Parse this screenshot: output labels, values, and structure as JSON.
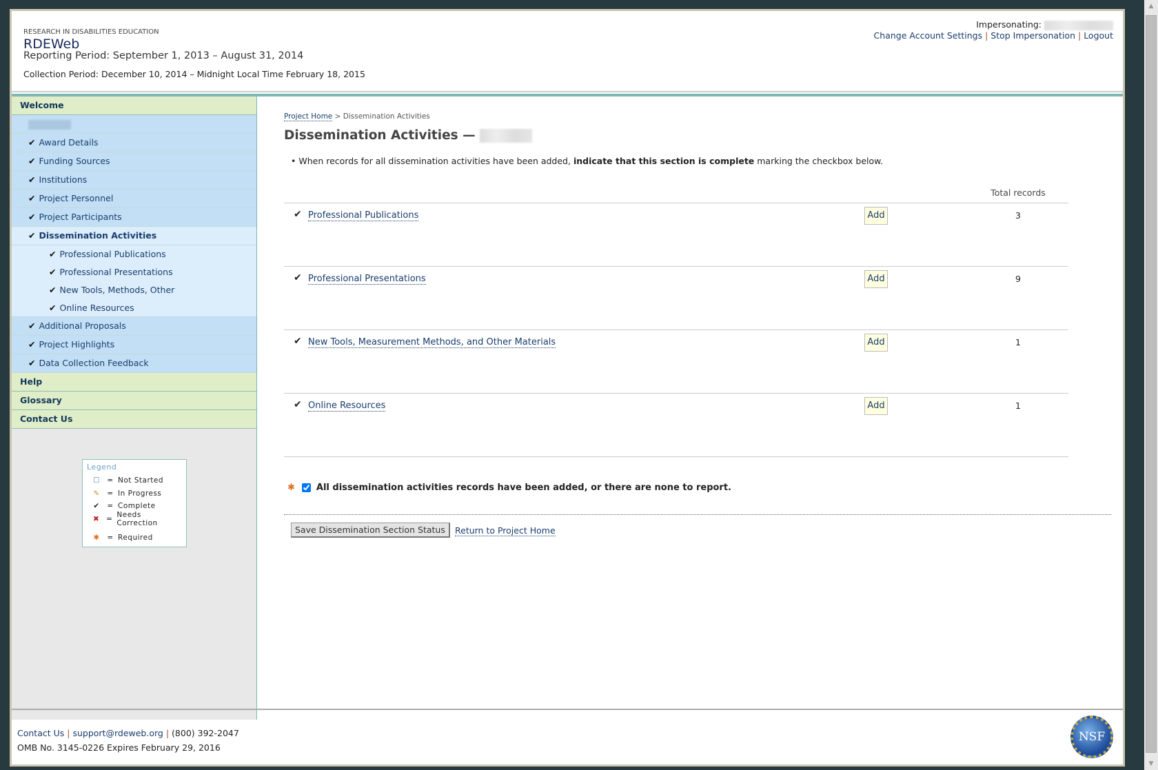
{
  "header": {
    "org": "RESEARCH IN DISABILITIES EDUCATION",
    "app_title": "RDEWeb",
    "reporting_period": "Reporting Period: September 1, 2013 – August 31, 2014",
    "collection_period": "Collection Period: December 10, 2014 – Midnight Local Time February 18, 2015",
    "impersonating_label": "Impersonating:",
    "links": [
      "Change Account Settings",
      "Stop Impersonation",
      "Logout"
    ],
    "sep": "|"
  },
  "sidebar": {
    "welcome": "Welcome",
    "items": [
      "Award Details",
      "Funding Sources",
      "Institutions",
      "Project Personnel",
      "Project Participants"
    ],
    "active": "Dissemination Activities",
    "sub_items": [
      "Professional Publications",
      "Professional Presentations",
      "New Tools, Methods, Other",
      "Online Resources"
    ],
    "items_after": [
      "Additional Proposals",
      "Project Highlights",
      "Data Collection Feedback"
    ],
    "sections": [
      "Help",
      "Glossary",
      "Contact Us"
    ],
    "check": "✔"
  },
  "legend": {
    "title": "Legend",
    "eq": "=",
    "items": [
      {
        "icon": "empty-box-icon",
        "glyph": "☐",
        "label": "Not Started"
      },
      {
        "icon": "pencil-icon",
        "glyph": "✎",
        "label": "In Progress"
      },
      {
        "icon": "check-icon",
        "glyph": "✔",
        "label": "Complete"
      },
      {
        "icon": "error-icon",
        "glyph": "✖",
        "label": "Needs Correction"
      },
      {
        "icon": "asterisk-icon",
        "glyph": "✱",
        "label": "Required"
      }
    ]
  },
  "main": {
    "breadcrumb_home": "Project Home",
    "breadcrumb_sep": ">",
    "breadcrumb_current": "Dissemination Activities",
    "title": "Dissemination Activities —",
    "note_pre": "When records for all dissemination activities have been added, ",
    "note_bold": "indicate that this section is complete",
    "note_post": " marking the checkbox below.",
    "bullet": "•",
    "total_header": "Total records",
    "add_label": "Add",
    "rows": [
      {
        "label": "Professional Publications",
        "count": "3"
      },
      {
        "label": "Professional Presentations",
        "count": "9"
      },
      {
        "label": "New Tools, Measurement Methods, and Other Materials",
        "count": "1"
      },
      {
        "label": "Online Resources",
        "count": "1"
      }
    ],
    "confirm_label": "All dissemination activities records have been added, or there are none to report.",
    "confirm_checked": true,
    "save_label": "Save Dissemination Section Status",
    "return_label": "Return to Project Home",
    "star": "✱"
  },
  "footer": {
    "contact": "Contact Us",
    "email": "support@rdeweb.org",
    "phone": "(800) 392-2047",
    "omb": "OMB No. 3145-0226 Expires February 29, 2016",
    "logo": "NSF"
  }
}
